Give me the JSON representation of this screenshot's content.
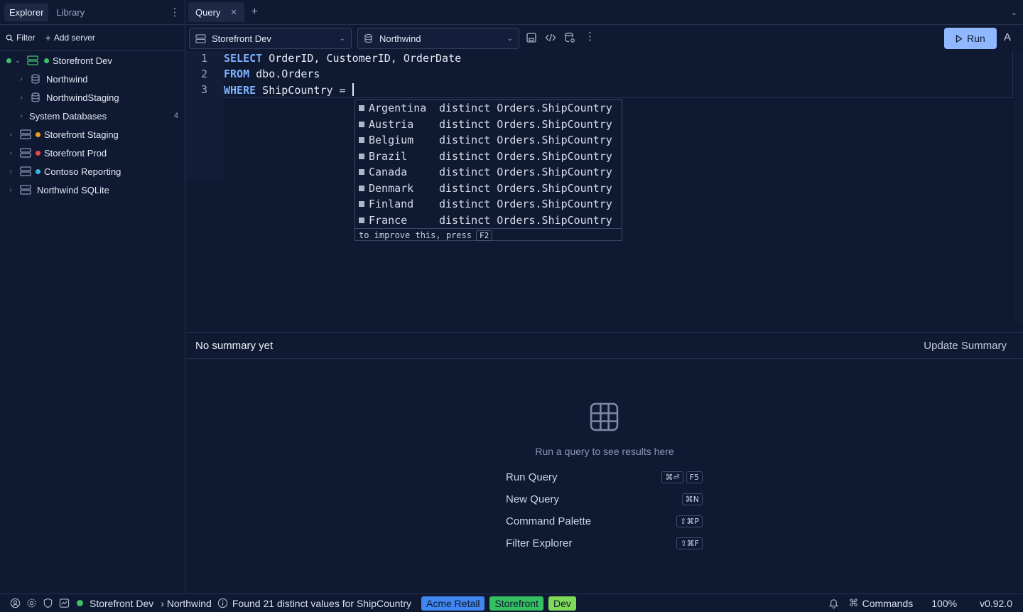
{
  "sidebar": {
    "tabs": [
      "Explorer",
      "Library"
    ],
    "actions": {
      "filter": "Filter",
      "add_server": "Add server"
    },
    "tree": [
      {
        "label": "Storefront Dev",
        "type": "server",
        "status": "connected",
        "status_color": "#3fbf6a",
        "expanded": true
      },
      {
        "label": "Northwind",
        "type": "database"
      },
      {
        "label": "NorthwindStaging",
        "type": "database"
      },
      {
        "label": "System Databases",
        "type": "folder",
        "count": "4"
      },
      {
        "label": "Storefront Staging",
        "type": "server",
        "status_color": "#f0a020"
      },
      {
        "label": "Storefront Prod",
        "type": "server",
        "status_color": "#e5484d"
      },
      {
        "label": "Contoso Reporting",
        "type": "server",
        "status_color": "#38b8e0"
      },
      {
        "label": "Northwind SQLite",
        "type": "server"
      }
    ]
  },
  "tabs": {
    "query_tab": "Query"
  },
  "toolbar": {
    "server": "Storefront Dev",
    "database": "Northwind",
    "run_label": "Run",
    "account_initial": "A"
  },
  "editor": {
    "lines": [
      {
        "num": "1",
        "keyword": "SELECT",
        "rest": " OrderID, CustomerID, OrderDate"
      },
      {
        "num": "2",
        "keyword": "FROM",
        "rest": " dbo.Orders"
      },
      {
        "num": "3",
        "keyword": "WHERE",
        "rest": " ShipCountry = "
      }
    ]
  },
  "autocomplete": {
    "items": [
      {
        "value": "Argentina",
        "detail": "distinct Orders.ShipCountry"
      },
      {
        "value": "Austria",
        "detail": "distinct Orders.ShipCountry"
      },
      {
        "value": "Belgium",
        "detail": "distinct Orders.ShipCountry"
      },
      {
        "value": "Brazil",
        "detail": "distinct Orders.ShipCountry"
      },
      {
        "value": "Canada",
        "detail": "distinct Orders.ShipCountry"
      },
      {
        "value": "Denmark",
        "detail": "distinct Orders.ShipCountry"
      },
      {
        "value": "Finland",
        "detail": "distinct Orders.ShipCountry"
      },
      {
        "value": "France",
        "detail": "distinct Orders.ShipCountry"
      }
    ],
    "footer_text": "to improve this, press",
    "footer_key": "F2"
  },
  "summary": {
    "text": "No summary yet",
    "update_label": "Update Summary"
  },
  "results": {
    "empty_text": "Run a query to see results here",
    "shortcuts": [
      {
        "label": "Run Query",
        "keys": [
          "⌘⏎",
          "F5"
        ]
      },
      {
        "label": "New Query",
        "keys": [
          "⌘N"
        ]
      },
      {
        "label": "Command Palette",
        "keys": [
          "⇧⌘P"
        ]
      },
      {
        "label": "Filter Explorer",
        "keys": [
          "⇧⌘F"
        ]
      }
    ]
  },
  "statusbar": {
    "connection": "Storefront Dev",
    "database_crumb": "› Northwind",
    "message": "Found 21 distinct values for ShipCountry",
    "tags": [
      {
        "label": "Acme Retail",
        "color": "#3f86f0"
      },
      {
        "label": "Storefront",
        "color": "#34c060"
      },
      {
        "label": "Dev",
        "color": "#7ed957"
      }
    ],
    "commands": "Commands",
    "zoom": "100%",
    "version": "v0.92.0"
  }
}
